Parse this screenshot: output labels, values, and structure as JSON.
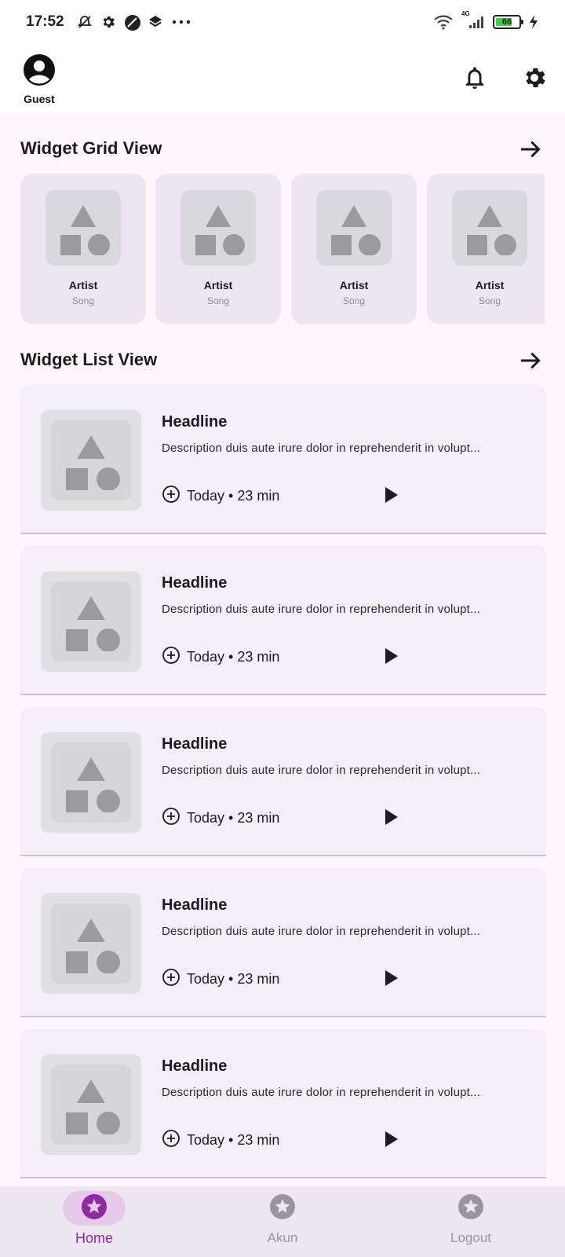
{
  "status_bar": {
    "time": "17:52",
    "battery": "66",
    "network": "4G",
    "icons": [
      "mute-icon",
      "gear-icon",
      "circle-app-icon",
      "layers-icon",
      "more-icon",
      "wifi-icon",
      "signal-icon",
      "battery-icon",
      "charging-icon"
    ]
  },
  "header": {
    "user_label": "Guest",
    "icons": [
      "account-icon",
      "bell-icon",
      "settings-icon"
    ]
  },
  "grid_section": {
    "title": "Widget Grid View",
    "items": [
      {
        "title": "Artist",
        "subtitle": "Song"
      },
      {
        "title": "Artist",
        "subtitle": "Song"
      },
      {
        "title": "Artist",
        "subtitle": "Song"
      },
      {
        "title": "Artist",
        "subtitle": "Song"
      }
    ]
  },
  "list_section": {
    "title": "Widget List View",
    "items": [
      {
        "headline": "Headline",
        "description": "Description duis aute irure dolor in reprehenderit in volupt...",
        "meta": "Today • 23 min"
      },
      {
        "headline": "Headline",
        "description": "Description duis aute irure dolor in reprehenderit in volupt...",
        "meta": "Today • 23 min"
      },
      {
        "headline": "Headline",
        "description": "Description duis aute irure dolor in reprehenderit in volupt...",
        "meta": "Today • 23 min"
      },
      {
        "headline": "Headline",
        "description": "Description duis aute irure dolor in reprehenderit in volupt...",
        "meta": "Today • 23 min"
      },
      {
        "headline": "Headline",
        "description": "Description duis aute irure dolor in reprehenderit in volupt...",
        "meta": "Today • 23 min"
      }
    ]
  },
  "bottom_nav": {
    "items": [
      {
        "label": "Home",
        "active": true
      },
      {
        "label": "Akun",
        "active": false
      },
      {
        "label": "Logout",
        "active": false
      }
    ]
  },
  "colors": {
    "accent": "#8e2aa0",
    "active_pill": "#e6c8ea",
    "background": "#fdf7fd",
    "card": "#f4eff6"
  }
}
